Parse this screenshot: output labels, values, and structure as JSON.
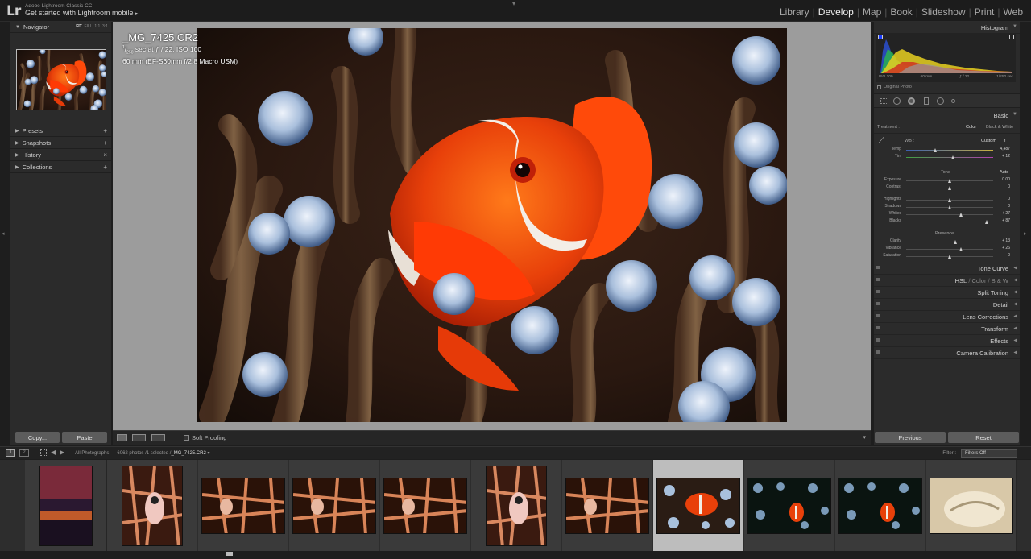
{
  "topbar": {
    "app_small": "Adobe Lightroom Classic CC",
    "mobile_link": "Get started with Lightroom mobile",
    "mobile_arrow": "▸",
    "logo": "Lr",
    "modules": [
      "Library",
      "Develop",
      "Map",
      "Book",
      "Slideshow",
      "Print",
      "Web"
    ],
    "active_module": "Develop"
  },
  "left_panel": {
    "navigator_title": "Navigator",
    "zoom_options": [
      "FIT",
      "FILL",
      "1:1",
      "3:1"
    ],
    "sections": [
      "Presets",
      "Snapshots",
      "History",
      "Collections"
    ],
    "section_actions": [
      "+",
      "+",
      "×",
      "+"
    ],
    "copy_label": "Copy...",
    "paste_label": "Paste"
  },
  "photo_info": {
    "filename": "_MG_7425.CR2",
    "exposure_line": "1/250 sec at ƒ / 22, ISO 100",
    "shutter_num": "1",
    "shutter_den": "250",
    "exposure_rest": " sec at ƒ / 22, ISO 100",
    "lens_line": "60 mm (EF-S60mm f/2.8 Macro USM)"
  },
  "toolbar": {
    "soft_proofing": "Soft Proofing",
    "view_icons": [
      "loupe-view-icon",
      "before-after-icon",
      "yy-compare-icon"
    ]
  },
  "histogram": {
    "title": "Histogram",
    "labels": [
      "ISO 100",
      "60 mm",
      "ƒ / 22",
      "1/250 sec"
    ],
    "original_photo": "Original Photo"
  },
  "basic": {
    "title": "Basic",
    "treatment_label": "Treatment :",
    "treatment_options": [
      "Color",
      "Black & White"
    ],
    "wb_label": "WB :",
    "wb_value": "Custom",
    "tone_label": "Tone",
    "auto_label": "Auto",
    "presence_label": "Presence",
    "sliders": [
      {
        "label": "Temp",
        "value": "4,487",
        "pos": 0.34
      },
      {
        "label": "Tint",
        "value": "+ 12",
        "pos": 0.54
      },
      {
        "label": "Exposure",
        "value": "0.00",
        "pos": 0.5
      },
      {
        "label": "Contrast",
        "value": "0",
        "pos": 0.5
      },
      {
        "label": "Highlights",
        "value": "0",
        "pos": 0.5
      },
      {
        "label": "Shadows",
        "value": "0",
        "pos": 0.5
      },
      {
        "label": "Whites",
        "value": "+ 27",
        "pos": 0.635
      },
      {
        "label": "Blacks",
        "value": "+ 87",
        "pos": 0.935
      },
      {
        "label": "Clarity",
        "value": "+ 13",
        "pos": 0.565
      },
      {
        "label": "Vibrance",
        "value": "+ 26",
        "pos": 0.63
      },
      {
        "label": "Saturation",
        "value": "0",
        "pos": 0.5
      }
    ]
  },
  "right_sections": [
    "Tone Curve",
    "HSL",
    "Split Toning",
    "Detail",
    "Lens Corrections",
    "Transform",
    "Effects",
    "Camera Calibration"
  ],
  "hsl_parts": [
    "HSL",
    "/",
    "Color",
    "/",
    "B & W"
  ],
  "right_footer": {
    "previous": "Previous",
    "reset": "Reset"
  },
  "filmstrip": {
    "screen_buttons": [
      "1",
      "2"
    ],
    "source": "All Photographs",
    "count": "6062 photos /1 selected /",
    "selected_file": "_MG_7425.CR2",
    "dropdown_arrow": "▾",
    "filter_label": "Filter :",
    "filter_value": "Filters Off",
    "selected_index": 7,
    "thumbs": [
      "sunset",
      "coral-portrait",
      "coral",
      "coral",
      "coral",
      "coral-portrait",
      "coral",
      "clownfish",
      "clownfish-dark",
      "clownfish-dark",
      "shell"
    ]
  },
  "colors": {
    "panel": "#2b2b2b",
    "background": "#1e1e1e",
    "canvas": "#9c9c9c",
    "selected_cell": "#bdbdbd",
    "fish_orange": "#e8400a"
  }
}
